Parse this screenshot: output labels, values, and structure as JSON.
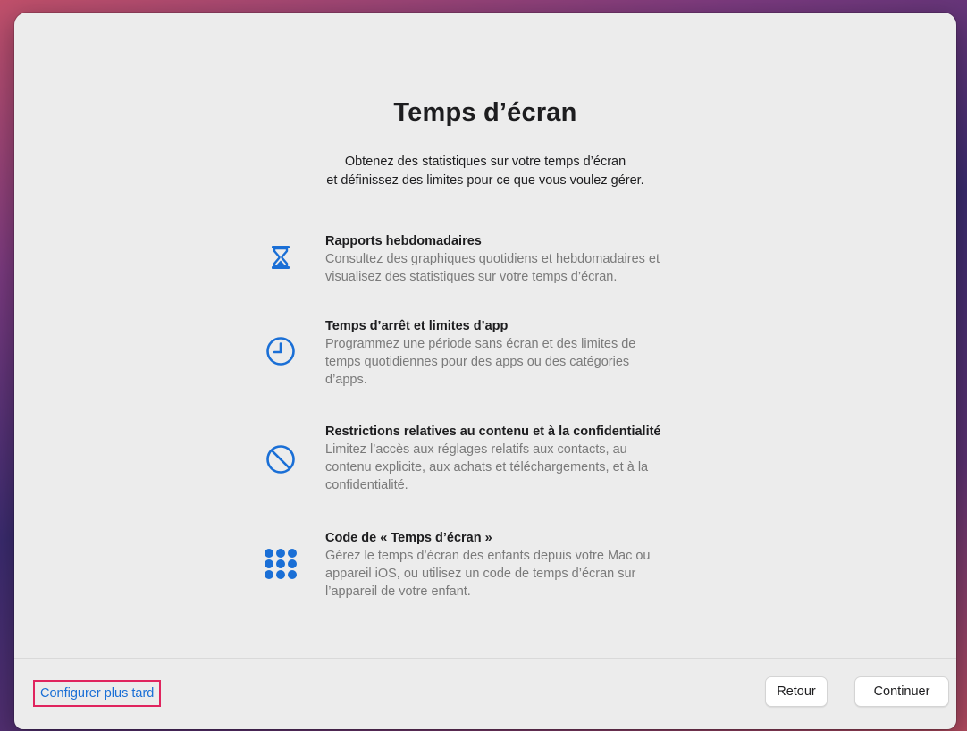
{
  "page": {
    "title": "Temps d’écran",
    "subtitle_lines": [
      "Obtenez des statistiques sur votre temps d’écran",
      "et définissez des limites pour ce que vous voulez gérer."
    ]
  },
  "features": [
    {
      "icon": "hourglass-icon",
      "title": "Rapports hebdomadaires",
      "desc_lines": [
        "Consultez des graphiques quotidiens et hebdomadaires et",
        "visualisez des statistiques sur votre temps d’écran."
      ]
    },
    {
      "icon": "clock-icon",
      "title": "Temps d’arrêt et limites d’app",
      "desc_lines": [
        "Programmez une période sans écran et des limites de",
        "temps quotidiennes pour des apps ou des catégories",
        "d’apps."
      ]
    },
    {
      "icon": "prohibited-icon",
      "title": "Restrictions relatives au contenu et à la confidentialité",
      "desc_lines": [
        "Limitez l’accès aux réglages relatifs aux contacts, au",
        "contenu explicite, aux achats et téléchargements, et à la",
        "confidentialité."
      ]
    },
    {
      "icon": "keypad-icon",
      "title": "Code de « Temps d’écran »",
      "desc_lines": [
        "Gérez le temps d’écran des enfants depuis votre Mac ou",
        "appareil iOS, ou utilisez un code de temps d’écran sur",
        "l’appareil de votre enfant."
      ]
    }
  ],
  "footer": {
    "later_label": "Configurer plus tard",
    "back_label": "Retour",
    "continue_label": "Continuer"
  },
  "colors": {
    "accent": "#1a6fd6",
    "highlight_border": "#e0245e"
  }
}
